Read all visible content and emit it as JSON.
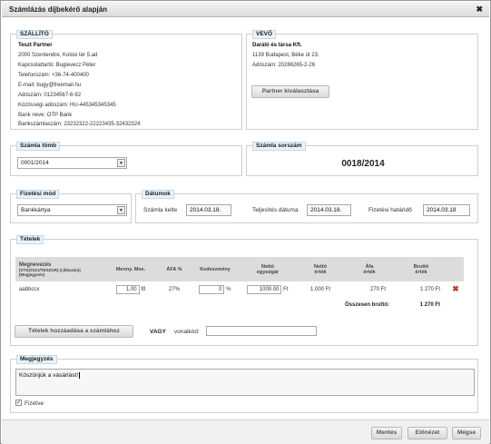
{
  "window": {
    "title": "Számlázás díjbekérő alapján"
  },
  "supplier": {
    "legend": "SZÁLLÍTÓ",
    "name": "Teszt Partner",
    "lines": [
      "2000 Szentendre, Kolosi tér 5.ad",
      "Kapcsolattartó: Buglevecz Péter",
      "Telefonszám: +36-74-400400",
      "E-mail: bugy@freemail.hu",
      "Adószám: 01234567-6-92",
      "Közösségi adószám: HU-445345345345",
      "Bank neve: OTP Bank",
      "Bankszámlaszám: 23232322-22223435-32432324"
    ]
  },
  "buyer": {
    "legend": "VEVŐ",
    "name": "Daráló és társa Kft.",
    "lines": [
      "1139 Budapest, Béke út 23.",
      "Adószám: 20286265-2-26"
    ],
    "select_button": "Partner kiválasztása"
  },
  "invoice_block": {
    "legend": "Számla tömb",
    "value": "0001/2014"
  },
  "invoice_number": {
    "legend": "Számla sorszám",
    "value": "0018/2014"
  },
  "payment": {
    "legend": "Fizetési mód",
    "value": "Bankkártya"
  },
  "dates": {
    "legend": "Dátumok",
    "issue_label": "Számla kelte",
    "issue_value": "2014.03.18.",
    "fulfil_label": "Teljesítés dátuma",
    "fulfil_value": "2014.03.18.",
    "due_label": "Fizetési határidő",
    "due_value": "2014.03.18"
  },
  "items": {
    "legend": "Tételek",
    "headers": {
      "name": "Megnevezés",
      "name_sub1": "(VTSZ/SZJ/TESZOR) (cikkszám)",
      "name_sub2": "(Megjegyzés)",
      "qty": "Menny. Mee.",
      "vat": "ÁFA %",
      "discount": "Kedvezmény",
      "net_unit": "Nettó",
      "net_unit2": "egységár",
      "net_value": "Nettó",
      "net_value2": "érték",
      "vat_value": "Áfa",
      "vat_value2": "érték",
      "gross": "Bruttó",
      "gross2": "érték"
    },
    "rows": [
      {
        "name": "aabbccx",
        "qty": "1.00",
        "unit": "fő",
        "vat": "27%",
        "discount": "0",
        "discount_unit": "%",
        "net_unit": "1000.00",
        "net_unit_cur": "Ft",
        "net_value": "1.000 Ft",
        "vat_value": "270 Ft",
        "gross": "1 270 Ft"
      }
    ],
    "total_label": "Összesen bruttó:",
    "total_value": "1 270 Ft",
    "add_button": "Tételek hozzáadása a számlához",
    "or_label": "VAGY",
    "barcode_label": "vonalkód:",
    "barcode_value": ""
  },
  "notes": {
    "legend": "Megjegyzés",
    "value": "Köszönjük a vásárlást!",
    "paid_label": "Fizetve",
    "paid_checked": true
  },
  "footer": {
    "save": "Mentés",
    "preview": "Előnézet",
    "cancel": "Mégse"
  },
  "icons": {
    "close": "close-icon",
    "delete": "delete-row-icon",
    "dropdown": "chevron-down-icon",
    "check": "checkmark-icon"
  },
  "colors": {
    "legend_bg": "#eaf3fa",
    "delete_red": "#c0392b",
    "header_gray": "#dcdcdc"
  }
}
